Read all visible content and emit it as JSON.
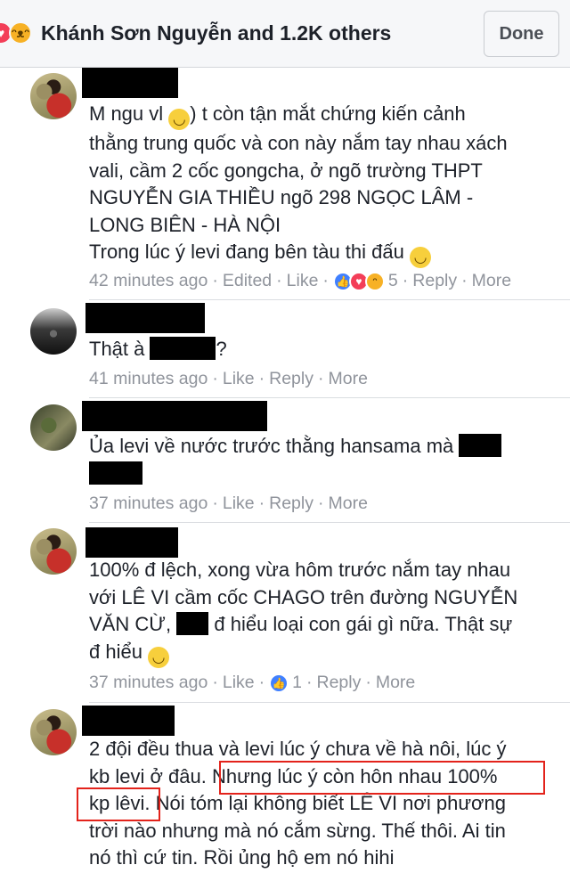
{
  "header": {
    "title": "Khánh Sơn Nguyễn and 1.2K others",
    "done_label": "Done",
    "reaction_icons": [
      "heart-icon",
      "haha-icon"
    ]
  },
  "comments": [
    {
      "avatar": "avatar-girl",
      "lines": [
        "M ngu vl ",
        ") t còn tận mắt chứng kiến cảnh",
        "thằng trung quốc và con này nắm tay nhau xách",
        "vali, cầm 2 cốc gongcha, ở ngõ trường THPT",
        "NGUYỄN GIA THIỀU ngõ 298 NGỌC LÂM -",
        "LONG BIÊN - HÀ NỘI",
        "Trong lúc ý levi đang bên tàu thi đấu "
      ],
      "time": "42 minutes ago",
      "edited": "Edited",
      "like": "Like",
      "reaction_count": "5",
      "reply": "Reply",
      "more": "More"
    },
    {
      "avatar": "avatar-dark",
      "text_before": "Thật à ",
      "text_after": "?",
      "time": "41 minutes ago",
      "like": "Like",
      "reply": "Reply",
      "more": "More"
    },
    {
      "avatar": "avatar-green",
      "text": "Ủa levi về nước trước thằng hansama mà",
      "time": "37 minutes ago",
      "like": "Like",
      "reply": "Reply",
      "more": "More"
    },
    {
      "avatar": "avatar-girl",
      "lines": [
        "100% đ lệch, xong vừa hôm trước nắm tay nhau",
        "với LÊ VI cầm cốc CHAGO trên đường NGUYỄN",
        "VĂN CỪ, ",
        " đ hiểu loại con gái gì nữa. Thật sự",
        "đ hiểu "
      ],
      "time": "37 minutes ago",
      "like": "Like",
      "reaction_count": "1",
      "reply": "Reply",
      "more": "More"
    },
    {
      "avatar": "avatar-girl",
      "lines": [
        "2 đội đều thua và levi lúc ý chưa về hà nôi, lúc ý",
        "kb levi ở đâu. ",
        "Nhưng lúc ý còn hôn nhau 100%",
        "kp lêvi.",
        " Nói tóm lại không biết LÊ VI nơi phương",
        "trời nào nhưng mà nó cắm sừng. Thế thôi. Ai tin",
        "nó thì cứ tin. Rồi ủng hộ em nó hihi"
      ]
    }
  ],
  "colors": {
    "highlight_box": "#e3231b",
    "meta_text": "#90949c",
    "like_blue": "#4080ff"
  }
}
